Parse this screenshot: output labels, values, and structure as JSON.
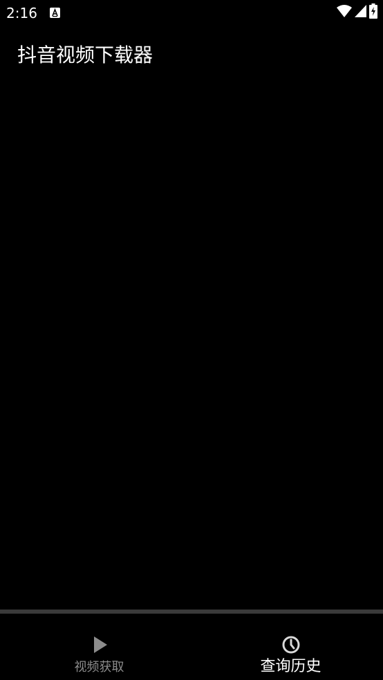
{
  "status_bar": {
    "time": "2:16",
    "notification_icon": "font-a-icon",
    "wifi_icon": "wifi-icon",
    "signal_icon": "cell-signal-icon",
    "battery_icon": "battery-charging-icon"
  },
  "app_bar": {
    "title": "抖音视频下载器"
  },
  "bottom_nav": {
    "items": [
      {
        "label": "视频获取",
        "icon": "play-icon",
        "active": false
      },
      {
        "label": "查询历史",
        "icon": "history-clock-icon",
        "active": true
      }
    ]
  },
  "colors": {
    "background": "#000000",
    "text_primary": "#ffffff",
    "text_inactive": "#8c8c8c",
    "nav_divider": "#3a3a3a"
  }
}
